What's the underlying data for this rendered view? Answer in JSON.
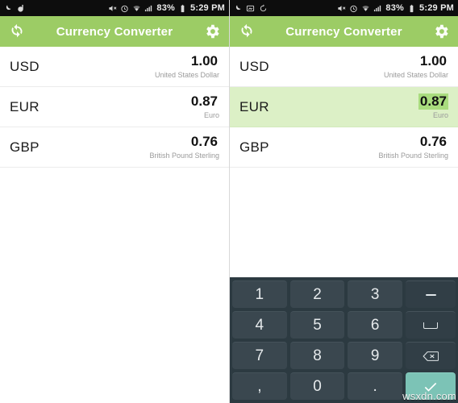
{
  "app": {
    "title": "Currency Converter",
    "header_color": "#9ccc65",
    "refresh_icon": "refresh-icon",
    "settings_icon": "gear-icon"
  },
  "statusbar": {
    "left_icons_left_panel": [
      "moon-icon",
      "app-notification-icon"
    ],
    "left_icons_right_panel": [
      "moon-icon",
      "screenshot-icon",
      "rotation-icon"
    ],
    "right_icons": [
      "mute-icon",
      "alarm-icon",
      "wifi-icon",
      "signal-icon"
    ],
    "battery": "83%",
    "battery_icon": "battery-icon",
    "time": "5:29 PM"
  },
  "currencies": [
    {
      "code": "USD",
      "amount": "1.00",
      "name": "United States Dollar",
      "selected": false
    },
    {
      "code": "EUR",
      "amount": "0.87",
      "name": "Euro",
      "selected": false
    },
    {
      "code": "GBP",
      "amount": "0.76",
      "name": "British Pound Sterling",
      "selected": false
    }
  ],
  "currencies_right": [
    {
      "code": "USD",
      "amount": "1.00",
      "name": "United States Dollar",
      "selected": false
    },
    {
      "code": "EUR",
      "amount": "0.87",
      "name": "Euro",
      "selected": true
    },
    {
      "code": "GBP",
      "amount": "0.76",
      "name": "British Pound Sterling",
      "selected": false
    }
  ],
  "keyboard": {
    "visible_on": "right",
    "background_color": "#2c3a41",
    "key_color": "#3a474f",
    "enter_color": "#7cc3b6",
    "rows": [
      {
        "keys": [
          {
            "label": "1",
            "name": "key-1",
            "type": "digit"
          },
          {
            "label": "2",
            "name": "key-2",
            "type": "digit"
          },
          {
            "label": "3",
            "name": "key-3",
            "type": "digit"
          },
          {
            "label": "-",
            "name": "key-minus",
            "type": "fn-dash"
          }
        ]
      },
      {
        "keys": [
          {
            "label": "4",
            "name": "key-4",
            "type": "digit"
          },
          {
            "label": "5",
            "name": "key-5",
            "type": "digit"
          },
          {
            "label": "6",
            "name": "key-6",
            "type": "digit"
          },
          {
            "label": "",
            "name": "key-space",
            "type": "fn-space"
          }
        ]
      },
      {
        "keys": [
          {
            "label": "7",
            "name": "key-7",
            "type": "digit"
          },
          {
            "label": "8",
            "name": "key-8",
            "type": "digit"
          },
          {
            "label": "9",
            "name": "key-9",
            "type": "digit"
          },
          {
            "label": "",
            "name": "key-backspace",
            "type": "fn-backspace"
          }
        ]
      },
      {
        "keys": [
          {
            "label": ",",
            "name": "key-comma",
            "type": "digit"
          },
          {
            "label": "0",
            "name": "key-0",
            "type": "digit"
          },
          {
            "label": ".",
            "name": "key-period",
            "type": "digit"
          },
          {
            "label": "",
            "name": "key-enter",
            "type": "enter-check"
          }
        ]
      }
    ]
  },
  "watermark": "wsxdn.com"
}
